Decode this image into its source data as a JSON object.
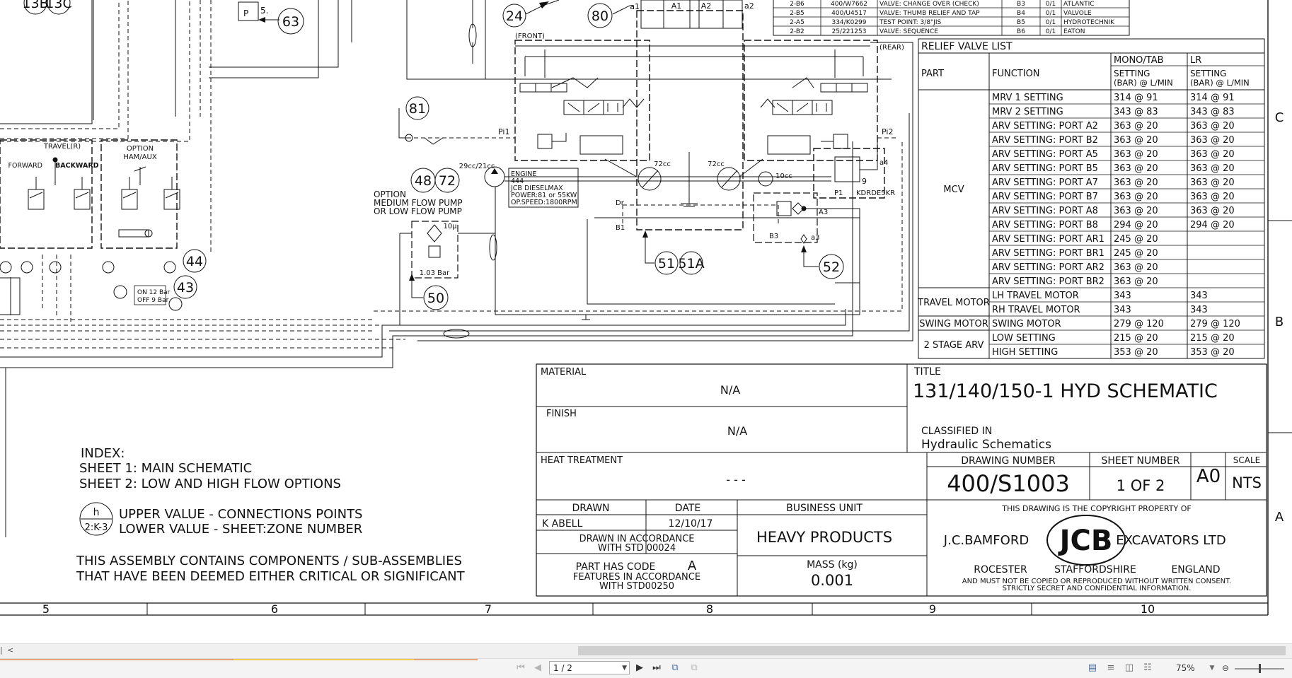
{
  "parts_table": {
    "rows": [
      [
        "2-B6",
        "400/W7662",
        "VALVE: CHANGE OVER (CHECK)",
        "B3",
        "0/1",
        "ATLANTIC"
      ],
      [
        "2-B5",
        "400/U4517",
        "VALVE: THUMB RELIEF AND TAP",
        "B4",
        "0/1",
        "VALVOLE"
      ],
      [
        "2-A5",
        "334/K0299",
        "TEST POINT: 3/8\"JIS",
        "B5",
        "0/1",
        "HYDROTECHNIK"
      ],
      [
        "2-B2",
        "25/221253",
        "VALVE: SEQUENCE",
        "B6",
        "0/1",
        "EATON"
      ]
    ]
  },
  "relief_valve": {
    "title": "RELIEF VALVE LIST",
    "h_part": "PART",
    "h_function": "FUNCTION",
    "h_mono": "MONO/TAB",
    "h_lr": "LR",
    "h_setting": "SETTING",
    "h_units": "(BAR) @ L/MIN",
    "groups": [
      {
        "part": "MCV",
        "rows": [
          [
            "MRV 1 SETTING",
            "314 @ 91",
            "314 @ 91"
          ],
          [
            "MRV 2 SETTING",
            "343 @ 83",
            "343 @ 83"
          ],
          [
            "ARV SETTING: PORT A2",
            "363 @ 20",
            "363 @ 20"
          ],
          [
            "ARV SETTING: PORT B2",
            "363 @ 20",
            "363 @ 20"
          ],
          [
            "ARV SETTING: PORT A5",
            "363 @ 20",
            "363 @ 20"
          ],
          [
            "ARV SETTING: PORT B5",
            "363 @ 20",
            "363 @ 20"
          ],
          [
            "ARV SETTING: PORT A7",
            "363 @ 20",
            "363 @ 20"
          ],
          [
            "ARV SETTING: PORT B7",
            "363 @ 20",
            "363 @ 20"
          ],
          [
            "ARV SETTING: PORT A8",
            "363 @ 20",
            "363 @ 20"
          ],
          [
            "ARV SETTING: PORT B8",
            "294 @ 20",
            "294 @ 20"
          ],
          [
            "ARV SETTING: PORT AR1",
            "245 @ 20",
            ""
          ],
          [
            "ARV SETTING: PORT BR1",
            "245 @ 20",
            ""
          ],
          [
            "ARV SETTING: PORT AR2",
            "363 @ 20",
            ""
          ],
          [
            "ARV SETTING: PORT BR2",
            "363 @ 20",
            ""
          ]
        ]
      },
      {
        "part": "TRAVEL MOTOR",
        "rows": [
          [
            "LH TRAVEL MOTOR",
            "343",
            "343"
          ],
          [
            "RH TRAVEL MOTOR",
            "343",
            "343"
          ]
        ]
      },
      {
        "part": "SWING MOTOR",
        "rows": [
          [
            "SWING MOTOR",
            "279 @ 120",
            "279 @ 120"
          ]
        ]
      },
      {
        "part": "2 STAGE ARV",
        "rows": [
          [
            "LOW SETTING",
            "215 @ 20",
            "215 @ 20"
          ],
          [
            "HIGH SETTING",
            "353 @ 20",
            "353 @ 20"
          ]
        ]
      }
    ]
  },
  "zones": {
    "rows": [
      "C",
      "B",
      "A"
    ],
    "cols": [
      "5",
      "6",
      "7",
      "8",
      "9",
      "10"
    ]
  },
  "schematic": {
    "front": "(FRONT)",
    "rear": "(REAR)",
    "travel_r": "TRAVEL(R)",
    "forward": "FORWARD",
    "backward": "BACKWARD",
    "option_ham": "OPTION",
    "option_ham2": "HAM/AUX",
    "option_pump": [
      "OPTION",
      "MEDIUM FLOW PUMP",
      "OR LOW FLOW PUMP"
    ],
    "pump_size": "29cc/21cc",
    "engine": [
      "ENGINE",
      "444",
      "JCB DIESELMAX",
      "POWER:81 or 55KW",
      "OP.SPEED:1800RPM"
    ],
    "pump72a": "72cc",
    "pump72b": "72cc",
    "pump10": "10cc",
    "filter": "10µ",
    "filter_bar": "1.03 Bar",
    "kdrd": "KDRDE5KR",
    "on_off": [
      "ON 12 Bar",
      "OFF 9 Bar"
    ],
    "port_labels": [
      "a1",
      "A1",
      "A2",
      "a2",
      "Pi1",
      "Pi2",
      "Dr",
      "B1",
      "B3",
      "a3",
      "A3",
      "a4",
      "P1",
      "P",
      "5.",
      "9"
    ],
    "balloons": [
      "13B",
      "13C",
      "63",
      "24",
      "80",
      "81",
      "48",
      "72",
      "51",
      "51A",
      "52",
      "50",
      "44",
      "43"
    ]
  },
  "index": {
    "title": "INDEX:",
    "sheet1": "SHEET 1: MAIN SCHEMATIC",
    "sheet2": "SHEET 2: LOW AND HIGH FLOW OPTIONS",
    "legend_top": "h",
    "legend_bottom": "2:K-3",
    "upper": "UPPER VALUE - CONNECTIONS POINTS",
    "lower": "LOWER VALUE - SHEET:ZONE NUMBER",
    "note1": "THIS ASSEMBLY CONTAINS COMPONENTS / SUB-ASSEMBLIES",
    "note2": "THAT HAVE BEEN DEEMED EITHER CRITICAL OR SIGNIFICANT"
  },
  "title_block": {
    "material_label": "MATERIAL",
    "material": "N/A",
    "finish_label": "FINISH",
    "finish": "N/A",
    "heat_label": "HEAT TREATMENT",
    "heat": "- - -",
    "title_label": "TITLE",
    "title": "131/140/150-1 HYD SCHEMATIC",
    "classified_label": "CLASSIFIED IN",
    "classified": "Hydraulic Schematics",
    "drawing_number_label": "DRAWING NUMBER",
    "drawing_number": "400/S1003",
    "sheet_number_label": "SHEET NUMBER",
    "sheet_number": "1 OF 2",
    "size": "A0",
    "scale_label": "SCALE",
    "scale": "NTS",
    "drawn_label": "DRAWN",
    "drawn": "K ABELL",
    "date_label": "DATE",
    "date": "12/10/17",
    "std1": "DRAWN IN ACCORDANCE",
    "std2": "WITH STD 00024",
    "code1": "PART HAS CODE",
    "code_letter": "A",
    "code2": "FEATURES IN ACCORDANCE",
    "code3": "WITH STD00250",
    "bu_label": "BUSINESS UNIT",
    "bu": "HEAVY PRODUCTS",
    "mass_label": "MASS (kg)",
    "mass": "0.001",
    "copyright": "THIS DRAWING IS THE COPYRIGHT PROPERTY OF",
    "company_left": "J.C.BAMFORD",
    "company_right": "EXCAVATORS LTD",
    "logo": "JCB",
    "loc1": "ROCESTER",
    "loc2": "STAFFORDSHIRE",
    "loc3": "ENGLAND",
    "legal1": "AND MUST NOT BE COPIED OR REPRODUCED WITHOUT WRITTEN CONSENT.",
    "legal2": "STRICTLY SECRET AND CONFIDENTIAL INFORMATION."
  },
  "viewer": {
    "scroll_left": "<",
    "page": "1 / 2",
    "zoom": "75%",
    "icons": [
      "first-page-icon",
      "prev-page-icon",
      "next-page-icon",
      "last-page-icon",
      "fit-page-icon",
      "fit-width-icon",
      "single-page-icon",
      "continuous-icon",
      "facing-icon",
      "facing-continuous-icon",
      "zoom-out-icon"
    ]
  }
}
